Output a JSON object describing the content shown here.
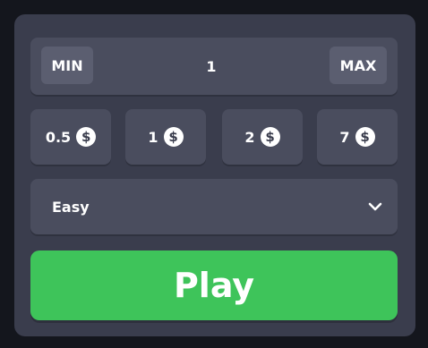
{
  "bet": {
    "min_label": "MIN",
    "value": "1",
    "max_label": "MAX"
  },
  "presets": [
    {
      "label": "0.5",
      "icon": "dollar-coin-icon"
    },
    {
      "label": "1",
      "icon": "dollar-coin-icon"
    },
    {
      "label": "2",
      "icon": "dollar-coin-icon"
    },
    {
      "label": "7",
      "icon": "dollar-coin-icon"
    }
  ],
  "difficulty": {
    "selected": "Easy",
    "icon": "chevron-down-icon"
  },
  "play_label": "Play",
  "colors": {
    "background": "#14161d",
    "panel": "#3a3d4d",
    "control": "#4a4d5e",
    "button": "#5b5e70",
    "play": "#3ec45a",
    "text": "#ffffff"
  }
}
